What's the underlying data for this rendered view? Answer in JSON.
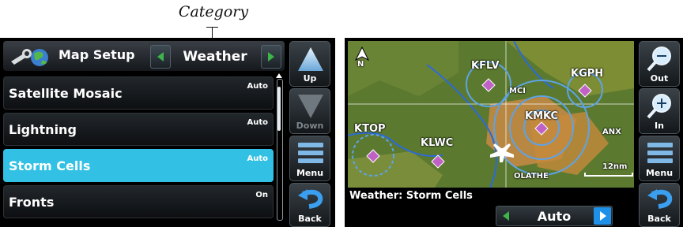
{
  "callout": {
    "label": "Category"
  },
  "left": {
    "header": {
      "title": "Map Setup",
      "category": "Weather"
    },
    "rows": [
      {
        "label": "Satellite Mosaic",
        "value": "Auto",
        "selected": false
      },
      {
        "label": "Lightning",
        "value": "Auto",
        "selected": false
      },
      {
        "label": "Storm Cells",
        "value": "Auto",
        "selected": true
      },
      {
        "label": "Fronts",
        "value": "On",
        "selected": false
      }
    ],
    "side": {
      "up": "Up",
      "down": "Down",
      "menu": "Menu",
      "back": "Back"
    }
  },
  "right": {
    "map": {
      "labels": {
        "kflv": "KFLV",
        "kgph": "KGPH",
        "mci": "MCI",
        "kmkc": "KMKC",
        "ktop": "KTOP",
        "klwc": "KLWC",
        "anx": "ANX",
        "olathe": "OLATHE",
        "scale": "12nm",
        "north": "N"
      }
    },
    "status": {
      "label": "Weather: Storm Cells",
      "value": "Auto"
    },
    "side": {
      "out": "Out",
      "in": "In",
      "menu": "Menu",
      "back": "Back"
    }
  },
  "colors": {
    "selected": "#32c1e4",
    "arrow_green": "#3db54a",
    "arrow_blue": "#1e90e8",
    "map_green": "#5c7a2e",
    "storm_magenta": "#c061c6"
  }
}
